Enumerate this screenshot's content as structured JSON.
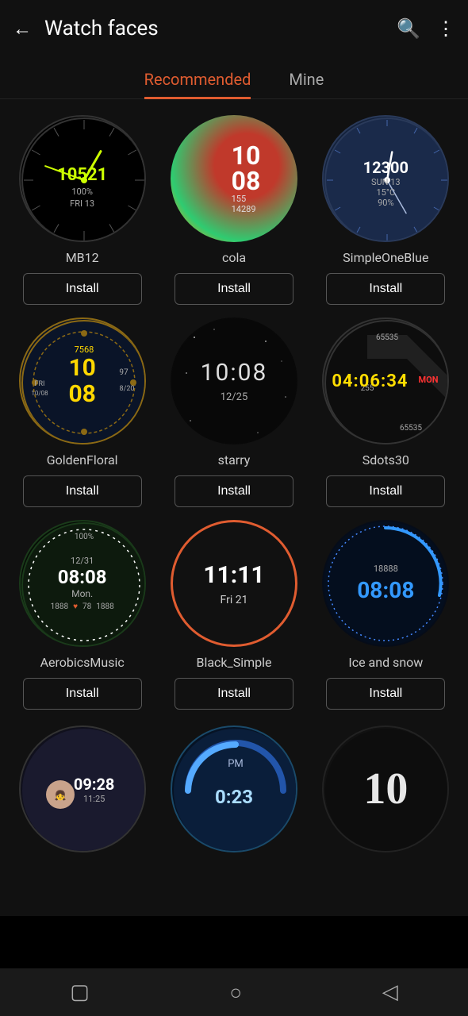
{
  "header": {
    "title": "Watch faces",
    "back_label": "←",
    "search_label": "🔍",
    "more_label": "⋮"
  },
  "tabs": [
    {
      "id": "recommended",
      "label": "Recommended",
      "active": true
    },
    {
      "id": "mine",
      "label": "Mine",
      "active": false
    }
  ],
  "watches": [
    {
      "id": "mb12",
      "name": "MB12",
      "style": "mb12",
      "time": "10521",
      "sub": "100%",
      "install_label": "Install"
    },
    {
      "id": "cola",
      "name": "cola",
      "style": "cola",
      "time_h": "10",
      "time_m": "08",
      "sub1": "155",
      "sub2": "14289",
      "install_label": "Install"
    },
    {
      "id": "simpleoneblue",
      "name": "SimpleOneBlue",
      "style": "simpleoneblue",
      "time": "12300",
      "temp": "15°C",
      "day": "SUN 13",
      "pct": "90%",
      "install_label": "Install"
    },
    {
      "id": "goldenfloral",
      "name": "GoldenFloral",
      "style": "goldenfloral",
      "time_h": "10",
      "time_m": "08",
      "date": "FRI 10/08",
      "sub": "8/20",
      "step": "7568",
      "install_label": "Install"
    },
    {
      "id": "starry",
      "name": "starry",
      "style": "starry",
      "time": "10:08",
      "date": "12/25",
      "install_label": "Install"
    },
    {
      "id": "sdots30",
      "name": "Sdots30",
      "style": "sdots30",
      "time": "04:06:34",
      "top": "65535",
      "sub1": "255",
      "sub2": "65535",
      "install_label": "Install"
    },
    {
      "id": "aerobicsmusic",
      "name": "AerobicsMusic",
      "style": "aerobicsmusic",
      "time": "08:08",
      "date": "12/31",
      "day": "Mon.",
      "sub1": "1888",
      "sub2": "78",
      "sub3": "1888",
      "pct": "100%",
      "install_label": "Install"
    },
    {
      "id": "blacksimple",
      "name": "Black_Simple",
      "style": "blacksimple",
      "time": "11:11",
      "date": "Fri 21",
      "install_label": "Install"
    },
    {
      "id": "icesnow",
      "name": "Ice and snow",
      "style": "icesnow",
      "num": "18888",
      "time": "08:08",
      "install_label": "Install"
    }
  ],
  "partial_watches": [
    {
      "id": "partial1",
      "style": "partial1",
      "time": "09:28",
      "sub": "11:25"
    },
    {
      "id": "partial2",
      "style": "partial2",
      "time": "0:23",
      "label": "PM"
    },
    {
      "id": "partial3",
      "style": "partial3",
      "time": "10"
    }
  ],
  "bottom_nav": {
    "square": "▢",
    "circle": "○",
    "triangle": "◁"
  }
}
